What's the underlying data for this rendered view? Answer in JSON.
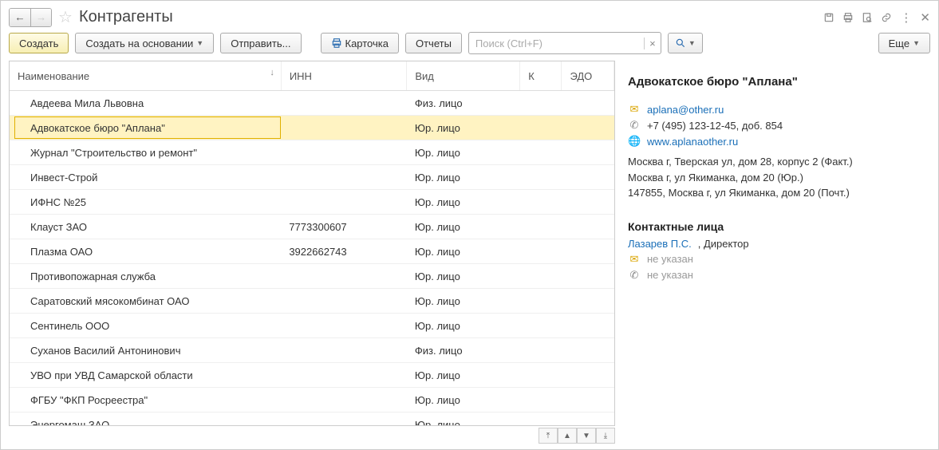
{
  "header": {
    "title": "Контрагенты"
  },
  "toolbar": {
    "create": "Создать",
    "create_based_on": "Создать на основании",
    "send": "Отправить...",
    "card": "Карточка",
    "reports": "Отчеты",
    "search_placeholder": "Поиск (Ctrl+F)",
    "more": "Еще"
  },
  "columns": {
    "name": "Наименование",
    "inn": "ИНН",
    "kind": "Вид",
    "k": "К",
    "edo": "ЭДО"
  },
  "rows": [
    {
      "name": "Авдеева Мила Львовна",
      "inn": "",
      "kind": "Физ. лицо",
      "selected": false
    },
    {
      "name": "Адвокатское бюро \"Аплана\"",
      "inn": "",
      "kind": "Юр. лицо",
      "selected": true
    },
    {
      "name": "Журнал \"Строительство и ремонт\"",
      "inn": "",
      "kind": "Юр. лицо",
      "selected": false
    },
    {
      "name": "Инвест-Строй",
      "inn": "",
      "kind": "Юр. лицо",
      "selected": false
    },
    {
      "name": "ИФНС №25",
      "inn": "",
      "kind": "Юр. лицо",
      "selected": false
    },
    {
      "name": "Клауст ЗАО",
      "inn": "7773300607",
      "kind": "Юр. лицо",
      "selected": false
    },
    {
      "name": "Плазма ОАО",
      "inn": "3922662743",
      "kind": "Юр. лицо",
      "selected": false
    },
    {
      "name": "Противопожарная служба",
      "inn": "",
      "kind": "Юр. лицо",
      "selected": false
    },
    {
      "name": "Саратовский мясокомбинат ОАО",
      "inn": "",
      "kind": "Юр. лицо",
      "selected": false
    },
    {
      "name": "Сентинель ООО",
      "inn": "",
      "kind": "Юр. лицо",
      "selected": false
    },
    {
      "name": "Суханов Василий Антонинович",
      "inn": "",
      "kind": "Физ. лицо",
      "selected": false
    },
    {
      "name": "УВО при УВД Самарской области",
      "inn": "",
      "kind": "Юр. лицо",
      "selected": false
    },
    {
      "name": "ФГБУ \"ФКП Росреестра\"",
      "inn": "",
      "kind": "Юр. лицо",
      "selected": false
    },
    {
      "name": "Энергомаш ЗАО",
      "inn": "",
      "kind": "Юр. лицо",
      "selected": false
    }
  ],
  "details": {
    "title": "Адвокатское бюро \"Аплана\"",
    "email": "aplana@other.ru",
    "phone": "+7 (495) 123-12-45, доб. 854",
    "website": "www.aplanaother.ru",
    "address_actual": "Москва г, Тверская ул, дом 28, корпус 2 (Факт.)",
    "address_legal": "Москва г, ул Якиманка, дом 20 (Юр.)",
    "address_postal": "147855, Москва г, ул Якиманка, дом 20 (Почт.)",
    "contacts_heading": "Контактные лица",
    "contact_name": "Лазарев П.С.",
    "contact_role_suffix": ", Директор",
    "contact_email_missing": "не указан",
    "contact_phone_missing": "не указан"
  }
}
